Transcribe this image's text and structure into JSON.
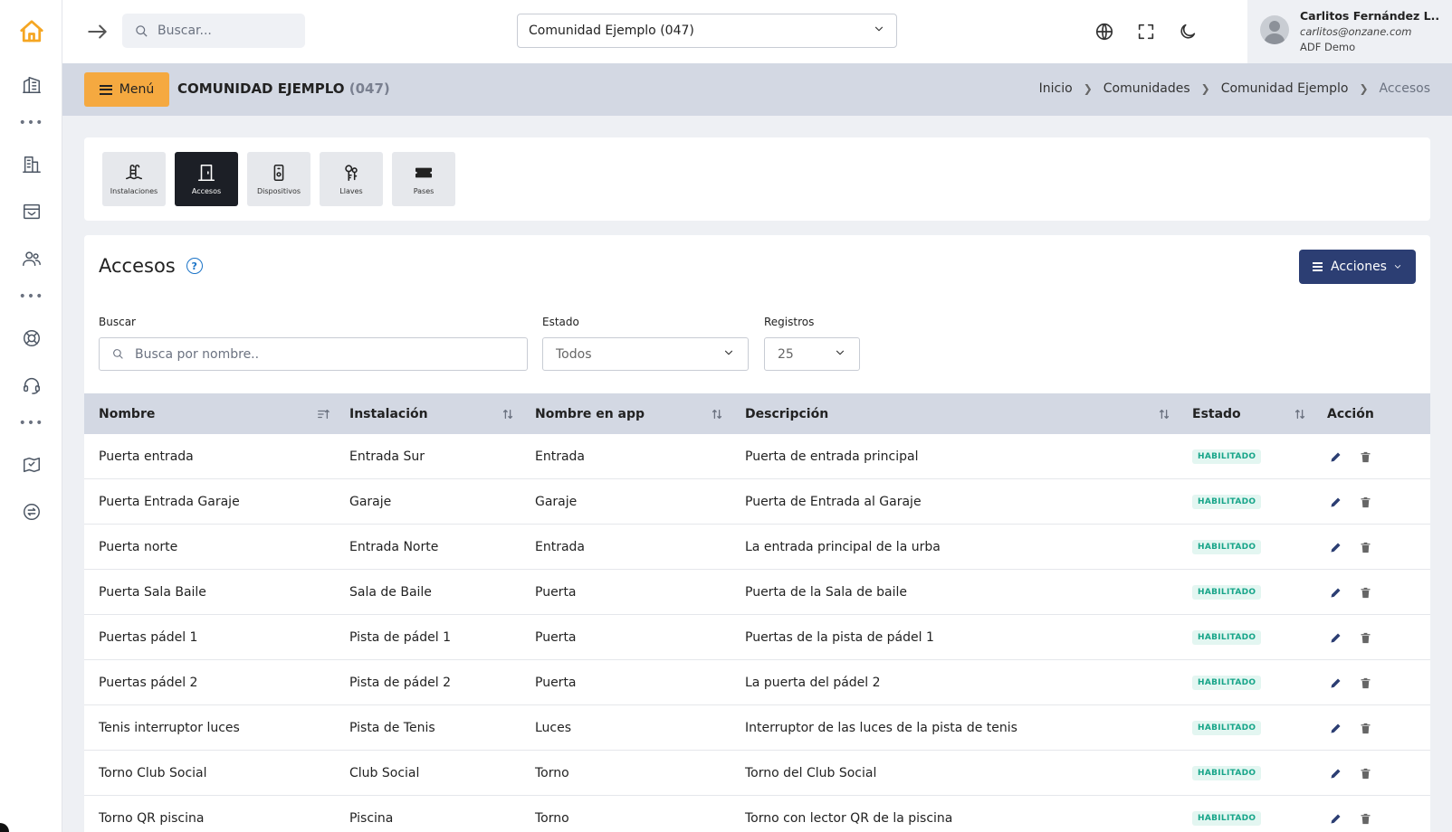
{
  "topbar": {
    "search_placeholder": "Buscar...",
    "community_selected": "Comunidad Ejemplo (047)"
  },
  "user": {
    "name": "Carlitos Fernández L..",
    "email": "carlitos@onzane.com",
    "org": "ADF Demo"
  },
  "header": {
    "menu_label": "Menú",
    "title": "COMUNIDAD EJEMPLO",
    "code": "(047)",
    "breadcrumb": [
      "Inicio",
      "Comunidades",
      "Comunidad Ejemplo",
      "Accesos"
    ]
  },
  "modules": [
    {
      "label": "Instalaciones",
      "icon": "pool-icon",
      "active": false
    },
    {
      "label": "Accesos",
      "icon": "door-icon",
      "active": true
    },
    {
      "label": "Dispositivos",
      "icon": "device-icon",
      "active": false
    },
    {
      "label": "Llaves",
      "icon": "keys-icon",
      "active": false
    },
    {
      "label": "Pases",
      "icon": "ticket-icon",
      "active": false
    }
  ],
  "section": {
    "title": "Accesos",
    "actions_label": "Acciones"
  },
  "filters": {
    "search_label": "Buscar",
    "search_placeholder": "Busca por nombre..",
    "status_label": "Estado",
    "status_value": "Todos",
    "records_label": "Registros",
    "records_value": "25"
  },
  "table": {
    "columns": [
      "Nombre",
      "Instalación",
      "Nombre en app",
      "Descripción",
      "Estado",
      "Acción"
    ],
    "rows": [
      {
        "nombre": "Puerta entrada",
        "instalacion": "Entrada Sur",
        "app": "Entrada",
        "descripcion": "Puerta de entrada principal",
        "estado": "HABILITADO"
      },
      {
        "nombre": "Puerta Entrada Garaje",
        "instalacion": "Garaje",
        "app": "Garaje",
        "descripcion": "Puerta de Entrada al Garaje",
        "estado": "HABILITADO"
      },
      {
        "nombre": "Puerta norte",
        "instalacion": "Entrada Norte",
        "app": "Entrada",
        "descripcion": "La entrada principal de la urba",
        "estado": "HABILITADO"
      },
      {
        "nombre": "Puerta Sala Baile",
        "instalacion": "Sala de Baile",
        "app": "Puerta",
        "descripcion": "Puerta de la Sala de baile",
        "estado": "HABILITADO"
      },
      {
        "nombre": "Puertas pádel 1",
        "instalacion": "Pista de pádel 1",
        "app": "Puerta",
        "descripcion": "Puertas de la pista de pádel 1",
        "estado": "HABILITADO"
      },
      {
        "nombre": "Puertas pádel 2",
        "instalacion": "Pista de pádel 2",
        "app": "Puerta",
        "descripcion": "La puerta del pádel 2",
        "estado": "HABILITADO"
      },
      {
        "nombre": "Tenis interruptor luces",
        "instalacion": "Pista de Tenis",
        "app": "Luces",
        "descripcion": "Interruptor de las luces de la pista de tenis",
        "estado": "HABILITADO"
      },
      {
        "nombre": "Torno Club Social",
        "instalacion": "Club Social",
        "app": "Torno",
        "descripcion": "Torno del Club Social",
        "estado": "HABILITADO"
      },
      {
        "nombre": "Torno QR piscina",
        "instalacion": "Piscina",
        "app": "Torno",
        "descripcion": "Torno con lector QR de la piscina",
        "estado": "HABILITADO"
      }
    ]
  },
  "colors": {
    "accent_orange": "#f5a940",
    "primary_navy": "#2c3e73",
    "status_green": "#17a589"
  }
}
